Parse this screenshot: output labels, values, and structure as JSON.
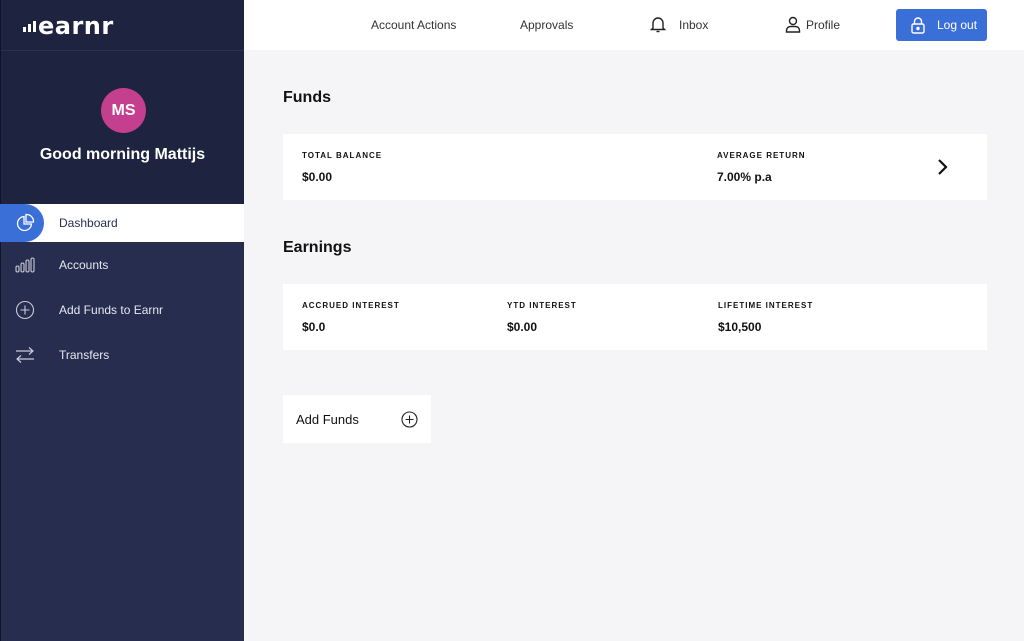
{
  "brand": {
    "name": "earnr"
  },
  "user": {
    "initials": "MS",
    "greeting": "Good morning Mattijs",
    "avatar_color": "#c43f8e"
  },
  "sidebar": {
    "items": [
      {
        "label": "Dashboard",
        "icon": "pie-chart-icon",
        "active": true
      },
      {
        "label": "Accounts",
        "icon": "bar-chart-icon",
        "active": false
      },
      {
        "label": "Add Funds to Earnr",
        "icon": "plus-circle-icon",
        "active": false
      },
      {
        "label": "Transfers",
        "icon": "transfer-arrows-icon",
        "active": false
      }
    ]
  },
  "header": {
    "account_actions": "Account Actions",
    "approvals": "Approvals",
    "inbox": "Inbox",
    "profile": "Profile",
    "logout": "Log out"
  },
  "funds": {
    "title": "Funds",
    "total_balance_label": "TOTAL BALANCE",
    "total_balance": "$0.00",
    "average_return_label": "AVERAGE RETURN",
    "average_return": "7.00% p.a"
  },
  "earnings": {
    "title": "Earnings",
    "accrued_label": "ACCRUED INTEREST",
    "accrued": "$0.0",
    "ytd_label": "YTD INTEREST",
    "ytd": "$0.00",
    "lifetime_label": "LIFETIME INTEREST",
    "lifetime": "$10,500"
  },
  "add_funds": {
    "label": "Add Funds"
  },
  "colors": {
    "accent": "#3b6fd8",
    "sidebar": "#262d4f",
    "sidebar_top": "#1e2340",
    "background": "#f5f5f7"
  }
}
